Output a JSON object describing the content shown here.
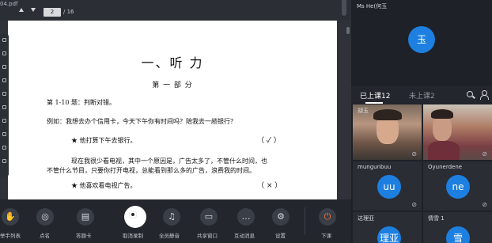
{
  "header": {
    "doc_name": "04.pdf",
    "page_current": "2",
    "page_total": "/ 16"
  },
  "document": {
    "title": "一、听 力",
    "subtitle": "第 一 部 分",
    "instruction": "第 1-10 题：判断对错。",
    "example_label": "例如：我想去办个信用卡，今天下午你有时间吗？陪我去一趟银行？",
    "item1_text": "★  他打算下午去银行。",
    "item1_mark": "（  ✓  ）",
    "para_line1": "现在我很少看电视，其中一个原因是，广告太多了，不管什么时间，也",
    "para_line2": "不管什么节目，只要你打开电视，总能看到那么多的广告，浪费我的时间。",
    "item2_text": "★  他喜欢看电视广告。",
    "item2_mark": "（  ×  ）"
  },
  "toolbar": {
    "buttons": [
      {
        "label": "举手列表",
        "icon": "hand-icon"
      },
      {
        "label": "点名",
        "icon": "location-icon"
      },
      {
        "label": "答题卡",
        "icon": "card-icon"
      },
      {
        "label": "取消录制",
        "icon": "record-icon"
      },
      {
        "label": "全员静音",
        "icon": "mute-all-icon"
      },
      {
        "label": "共享窗口",
        "icon": "share-screen-icon"
      },
      {
        "label": "互动消息",
        "icon": "chat-icon"
      },
      {
        "label": "设置",
        "icon": "gear-icon"
      },
      {
        "label": "下课",
        "icon": "power-icon"
      }
    ]
  },
  "sidebar": {
    "teacher_name": "Ms He(何玉",
    "teacher_avatar": "玉",
    "tab_active": "已上课12",
    "tab_inactive": "未上课2",
    "tiles": [
      {
        "name": "胡玉",
        "avatar": ""
      },
      {
        "name": "",
        "avatar": ""
      },
      {
        "name": "mungunbuu",
        "avatar": "uu"
      },
      {
        "name": "Oyunerdene",
        "avatar": "ne"
      },
      {
        "name": "达理亚",
        "avatar": "理亚"
      },
      {
        "name": "情雪 1",
        "avatar": "雪"
      }
    ]
  },
  "colors": {
    "accent": "#1d7fe0",
    "leave": "#ff7a3d",
    "panel": "#1e2128",
    "tile": "#2a2d34"
  }
}
